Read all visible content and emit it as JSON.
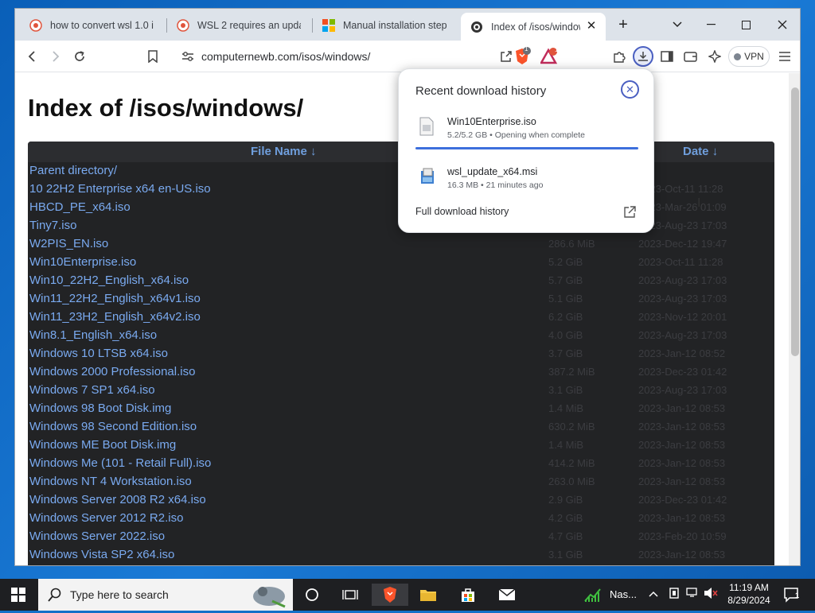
{
  "tabs": [
    {
      "label": "how to convert wsl 1.0 in"
    },
    {
      "label": "WSL 2 requires an update"
    },
    {
      "label": "Manual installation steps"
    },
    {
      "label": "Index of /isos/windows/"
    }
  ],
  "toolbar": {
    "url": "computernewb.com/isos/windows/",
    "vpn_label": "VPN",
    "brave_badge": "1",
    "rewards_badge": "1"
  },
  "page": {
    "title": "Index of /isos/windows/",
    "columns": {
      "name": "File Name  ↓",
      "date": "Date  ↓"
    },
    "files": [
      {
        "name": "Parent directory/",
        "size": "",
        "date": ""
      },
      {
        "name": "10 22H2 Enterprise x64 en-US.iso",
        "size": "",
        "date": "2023-Oct-11 11:28"
      },
      {
        "name": "HBCD_PE_x64.iso",
        "size": "",
        "date": "2023-Mar-26 01:09"
      },
      {
        "name": "Tiny7.iso",
        "size": "",
        "date": "2023-Aug-23 17:03"
      },
      {
        "name": "W2PIS_EN.iso",
        "size": "286.6 MiB",
        "date": "2023-Dec-12 19:47"
      },
      {
        "name": "Win10Enterprise.iso",
        "size": "5.2 GiB",
        "date": "2023-Oct-11 11:28"
      },
      {
        "name": "Win10_22H2_English_x64.iso",
        "size": "5.7 GiB",
        "date": "2023-Aug-23 17:03"
      },
      {
        "name": "Win11_22H2_English_x64v1.iso",
        "size": "5.1 GiB",
        "date": "2023-Aug-23 17:03"
      },
      {
        "name": "Win11_23H2_English_x64v2.iso",
        "size": "6.2 GiB",
        "date": "2023-Nov-12 20:01"
      },
      {
        "name": "Win8.1_English_x64.iso",
        "size": "4.0 GiB",
        "date": "2023-Aug-23 17:03"
      },
      {
        "name": "Windows 10 LTSB x64.iso",
        "size": "3.7 GiB",
        "date": "2023-Jan-12 08:52"
      },
      {
        "name": "Windows 2000 Professional.iso",
        "size": "387.2 MiB",
        "date": "2023-Dec-23 01:42"
      },
      {
        "name": "Windows 7 SP1 x64.iso",
        "size": "3.1 GiB",
        "date": "2023-Aug-23 17:03"
      },
      {
        "name": "Windows 98 Boot Disk.img",
        "size": "1.4 MiB",
        "date": "2023-Jan-12 08:53"
      },
      {
        "name": "Windows 98 Second Edition.iso",
        "size": "630.2 MiB",
        "date": "2023-Jan-12 08:53"
      },
      {
        "name": "Windows ME Boot Disk.img",
        "size": "1.4 MiB",
        "date": "2023-Jan-12 08:53"
      },
      {
        "name": "Windows Me (101 - Retail Full).iso",
        "size": "414.2 MiB",
        "date": "2023-Jan-12 08:53"
      },
      {
        "name": "Windows NT 4 Workstation.iso",
        "size": "263.0 MiB",
        "date": "2023-Jan-12 08:53"
      },
      {
        "name": "Windows Server 2008 R2 x64.iso",
        "size": "2.9 GiB",
        "date": "2023-Dec-23 01:42"
      },
      {
        "name": "Windows Server 2012 R2.iso",
        "size": "4.2 GiB",
        "date": "2023-Jan-12 08:53"
      },
      {
        "name": "Windows Server 2022.iso",
        "size": "4.7 GiB",
        "date": "2023-Feb-20 10:59"
      },
      {
        "name": "Windows Vista SP2 x64.iso",
        "size": "3.1 GiB",
        "date": "2023-Jan-12 08:53"
      }
    ]
  },
  "downloads": {
    "title": "Recent download history",
    "items": [
      {
        "name": "Win10Enterprise.iso",
        "meta": "5.2/5.2 GB • Opening when complete",
        "progress": 1.0
      },
      {
        "name": "wsl_update_x64.msi",
        "meta": "16.3 MB • 21 minutes ago"
      }
    ],
    "full_history": "Full download history"
  },
  "taskbar": {
    "search_placeholder": "Type here to search",
    "tray_app": "Nas...",
    "time": "11:19 AM",
    "date": "8/29/2024",
    "notifications": "1"
  },
  "colors": {
    "link": "#7aaaf0",
    "listing_bg": "#222325",
    "accent": "#3d6fdc",
    "taskbar": "#1e1f22"
  }
}
